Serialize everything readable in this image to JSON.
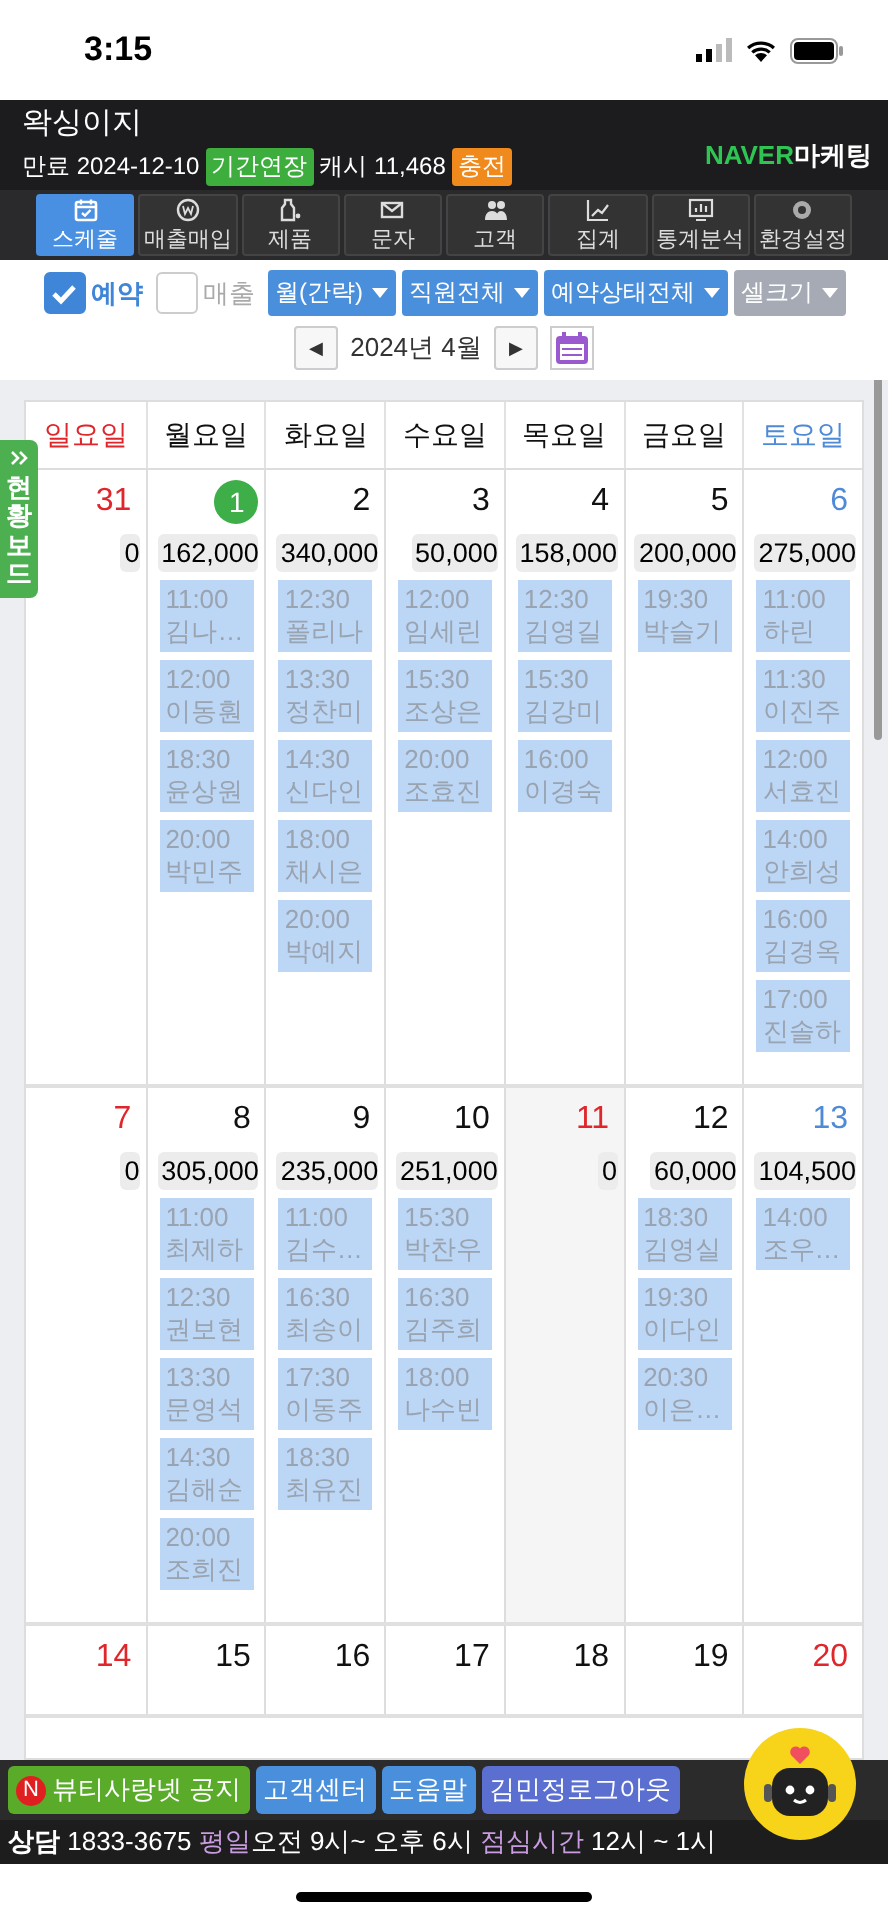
{
  "status_bar": {
    "time": "3:15"
  },
  "header": {
    "title": "왁싱이지",
    "expiry": "만료 2024-12-10",
    "extend_badge": "기간연장",
    "cash": "캐시 11,468",
    "charge_badge": "충전",
    "logo": {
      "brand": "NAVER",
      "suffix": "마케팅"
    }
  },
  "nav": [
    {
      "label": "스케줄",
      "selected": true
    },
    {
      "label": "매출매입",
      "selected": false
    },
    {
      "label": "제품",
      "selected": false
    },
    {
      "label": "문자",
      "selected": false
    },
    {
      "label": "고객",
      "selected": false
    },
    {
      "label": "집계",
      "selected": false
    },
    {
      "label": "통계분석",
      "selected": false
    },
    {
      "label": "환경설정",
      "selected": false
    }
  ],
  "filters": {
    "checks": [
      {
        "label": "예약",
        "checked": true
      },
      {
        "label": "매출",
        "checked": false
      }
    ],
    "dropdowns": [
      {
        "label": "월(간략)",
        "disabled": false
      },
      {
        "label": "직원전체",
        "disabled": false
      },
      {
        "label": "예약상태전체",
        "disabled": false
      },
      {
        "label": "셀크기",
        "disabled": true
      }
    ]
  },
  "month_nav": {
    "prev": "◀",
    "label": "2024년 4월",
    "next": "▶"
  },
  "side_tab": {
    "label": "현황보드"
  },
  "calendar": {
    "weekdays": [
      {
        "label": "일요일",
        "kind": "sunday"
      },
      {
        "label": "월요일",
        "kind": "weekday"
      },
      {
        "label": "화요일",
        "kind": "weekday"
      },
      {
        "label": "수요일",
        "kind": "weekday"
      },
      {
        "label": "목요일",
        "kind": "weekday"
      },
      {
        "label": "금요일",
        "kind": "weekday"
      },
      {
        "label": "토요일",
        "kind": "saturday"
      }
    ],
    "weeks": [
      {
        "days": [
          {
            "date": "31",
            "kind": "sunday",
            "today": false,
            "amount": "0"
          },
          {
            "date": "1",
            "kind": "weekday",
            "today": true,
            "amount": "162,000",
            "appointments": [
              {
                "time": "11:00",
                "name": "김나…"
              },
              {
                "time": "12:00",
                "name": "이동훤"
              },
              {
                "time": "18:30",
                "name": "윤상원"
              },
              {
                "time": "20:00",
                "name": "박민주"
              }
            ]
          },
          {
            "date": "2",
            "kind": "weekday",
            "today": false,
            "amount": "340,000",
            "appointments": [
              {
                "time": "12:30",
                "name": "폴리나"
              },
              {
                "time": "13:30",
                "name": "정찬미"
              },
              {
                "time": "14:30",
                "name": "신다인"
              },
              {
                "time": "18:00",
                "name": "채시은"
              },
              {
                "time": "20:00",
                "name": "박예지"
              }
            ]
          },
          {
            "date": "3",
            "kind": "weekday",
            "today": false,
            "amount": "50,000",
            "appointments": [
              {
                "time": "12:00",
                "name": "임세린"
              },
              {
                "time": "15:30",
                "name": "조상은"
              },
              {
                "time": "20:00",
                "name": "조효진"
              }
            ]
          },
          {
            "date": "4",
            "kind": "weekday",
            "today": false,
            "amount": "158,000",
            "appointments": [
              {
                "time": "12:30",
                "name": "김영길"
              },
              {
                "time": "15:30",
                "name": "김강미"
              },
              {
                "time": "16:00",
                "name": "이경숙"
              }
            ]
          },
          {
            "date": "5",
            "kind": "weekday",
            "today": false,
            "amount": "200,000",
            "appointments": [
              {
                "time": "19:30",
                "name": "박슬기"
              }
            ]
          },
          {
            "date": "6",
            "kind": "saturday",
            "today": false,
            "amount": "275,000",
            "appointments": [
              {
                "time": "11:00",
                "name": "하린"
              },
              {
                "time": "11:30",
                "name": "이진주"
              },
              {
                "time": "12:00",
                "name": "서효진"
              },
              {
                "time": "14:00",
                "name": "안희성"
              },
              {
                "time": "16:00",
                "name": "김경옥"
              },
              {
                "time": "17:00",
                "name": "진솔하"
              }
            ]
          }
        ]
      },
      {
        "days": [
          {
            "date": "7",
            "kind": "sunday",
            "today": false,
            "amount": "0"
          },
          {
            "date": "8",
            "kind": "weekday",
            "today": false,
            "amount": "305,000",
            "appointments": [
              {
                "time": "11:00",
                "name": "최제하"
              },
              {
                "time": "12:30",
                "name": "권보현"
              },
              {
                "time": "13:30",
                "name": "문영석"
              },
              {
                "time": "14:30",
                "name": "김해순"
              },
              {
                "time": "20:00",
                "name": "조희진"
              }
            ]
          },
          {
            "date": "9",
            "kind": "weekday",
            "today": false,
            "amount": "235,000",
            "appointments": [
              {
                "time": "11:00",
                "name": "김수…"
              },
              {
                "time": "16:30",
                "name": "최송이"
              },
              {
                "time": "17:30",
                "name": "이동주"
              },
              {
                "time": "18:30",
                "name": "최유진"
              }
            ]
          },
          {
            "date": "10",
            "kind": "weekday",
            "today": false,
            "amount": "251,000",
            "appointments": [
              {
                "time": "15:30",
                "name": "박찬우"
              },
              {
                "time": "16:30",
                "name": "김주희"
              },
              {
                "time": "18:00",
                "name": "나수빈"
              }
            ]
          },
          {
            "date": "11",
            "kind": "holiday",
            "today": false,
            "amount": "0"
          },
          {
            "date": "12",
            "kind": "weekday",
            "today": false,
            "amount": "60,000",
            "appointments": [
              {
                "time": "18:30",
                "name": "김영실"
              },
              {
                "time": "19:30",
                "name": "이다인"
              },
              {
                "time": "20:30",
                "name": "이은…"
              }
            ]
          },
          {
            "date": "13",
            "kind": "saturday",
            "today": false,
            "amount": "104,500",
            "appointments": [
              {
                "time": "14:00",
                "name": "조우…"
              }
            ]
          }
        ]
      },
      {
        "days": [
          {
            "date": "14",
            "kind": "sunday",
            "today": false
          },
          {
            "date": "15",
            "kind": "weekday",
            "today": false
          },
          {
            "date": "16",
            "kind": "weekday",
            "today": false
          },
          {
            "date": "17",
            "kind": "weekday",
            "today": false
          },
          {
            "date": "18",
            "kind": "weekday",
            "today": false
          },
          {
            "date": "19",
            "kind": "weekday",
            "today": false
          },
          {
            "date": "20",
            "kind": "sunday",
            "today": false
          }
        ]
      }
    ]
  },
  "footer": {
    "buttons": [
      {
        "label": "뷰티사랑넷 공지",
        "kind": "notice",
        "badge": "N"
      },
      {
        "label": "고객센터",
        "kind": "blue"
      },
      {
        "label": "도움말",
        "kind": "blue"
      },
      {
        "label": "김민정로그아웃",
        "kind": "purple"
      }
    ],
    "contact": [
      {
        "text": "상담",
        "kind": "bold"
      },
      {
        "text": " 1833-3675 ",
        "kind": "plain"
      },
      {
        "text": "평일",
        "kind": "accent"
      },
      {
        "text": "오전 9시~ 오후 6시 ",
        "kind": "plain"
      },
      {
        "text": "점심시간",
        "kind": "accent"
      },
      {
        "text": " 12시 ~ 1시",
        "kind": "plain"
      }
    ]
  }
}
